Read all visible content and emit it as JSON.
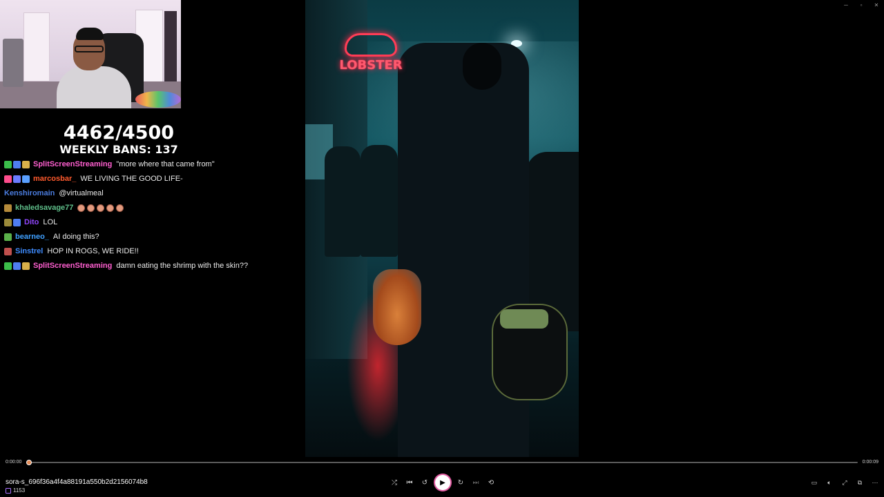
{
  "window": {
    "controls": [
      "─",
      "□",
      "✕"
    ]
  },
  "overlay": {
    "count": "4462/4500",
    "weekly_bans": "WEEKLY BANS: 137"
  },
  "chat": [
    {
      "user": "SplitScreenStreaming",
      "color": "#ff5fd0",
      "badges": [
        "#3bbd4a",
        "#4f7df0",
        "#d9b04a"
      ],
      "message": "\"more where that came from\""
    },
    {
      "user": "marcosbar_",
      "color": "#ff5a2d",
      "badges": [
        "#ff4d8d",
        "#6b7cff",
        "#5aa0ff"
      ],
      "message": "WE LIVING THE GOOD LIFE-"
    },
    {
      "user": "Kenshiromain",
      "color": "#4b7de0",
      "badges": [],
      "message": "@virtualmeal"
    },
    {
      "user": "khaledsavage77",
      "color": "#5fbf8a",
      "badges": [
        "#b58a3a"
      ],
      "message": ""
    },
    {
      "user": "Dito",
      "color": "#9146ff",
      "badges": [
        "#9b8a3a",
        "#4f7df0"
      ],
      "message": "LOL"
    },
    {
      "user": "bearneo_",
      "color": "#3fa0ff",
      "badges": [
        "#5ab04a"
      ],
      "message": "AI doing this?"
    },
    {
      "user": "Sinstrel",
      "color": "#3f8cff",
      "badges": [
        "#c0504d"
      ],
      "message": "HOP IN ROGS, WE RIDE!!"
    },
    {
      "user": "SplitScreenStreaming",
      "color": "#ff5fd0",
      "badges": [
        "#3bbd4a",
        "#4f7df0",
        "#d9b04a"
      ],
      "message": "damn eating the shrimp with the skin??"
    }
  ],
  "video": {
    "neon_sign": "LOBSTER"
  },
  "player": {
    "time_current": "0:00:00",
    "time_total": "0:00:09",
    "progress": 0.0,
    "filename": "sora-s_696f36a4f4a88191a550b2d2156074b8",
    "viewers": "1153",
    "controls": {
      "shuffle": "shuffle-icon",
      "previous": "previous-icon",
      "rewind": "rewind-10-icon",
      "play": "play-icon",
      "forward": "forward-30-icon",
      "next": "next-icon",
      "repeat": "repeat-off-icon"
    },
    "right_controls": [
      "miniplayer-icon",
      "volume-icon",
      "fullscreen-icon",
      "cast-icon",
      "more-icon"
    ]
  }
}
